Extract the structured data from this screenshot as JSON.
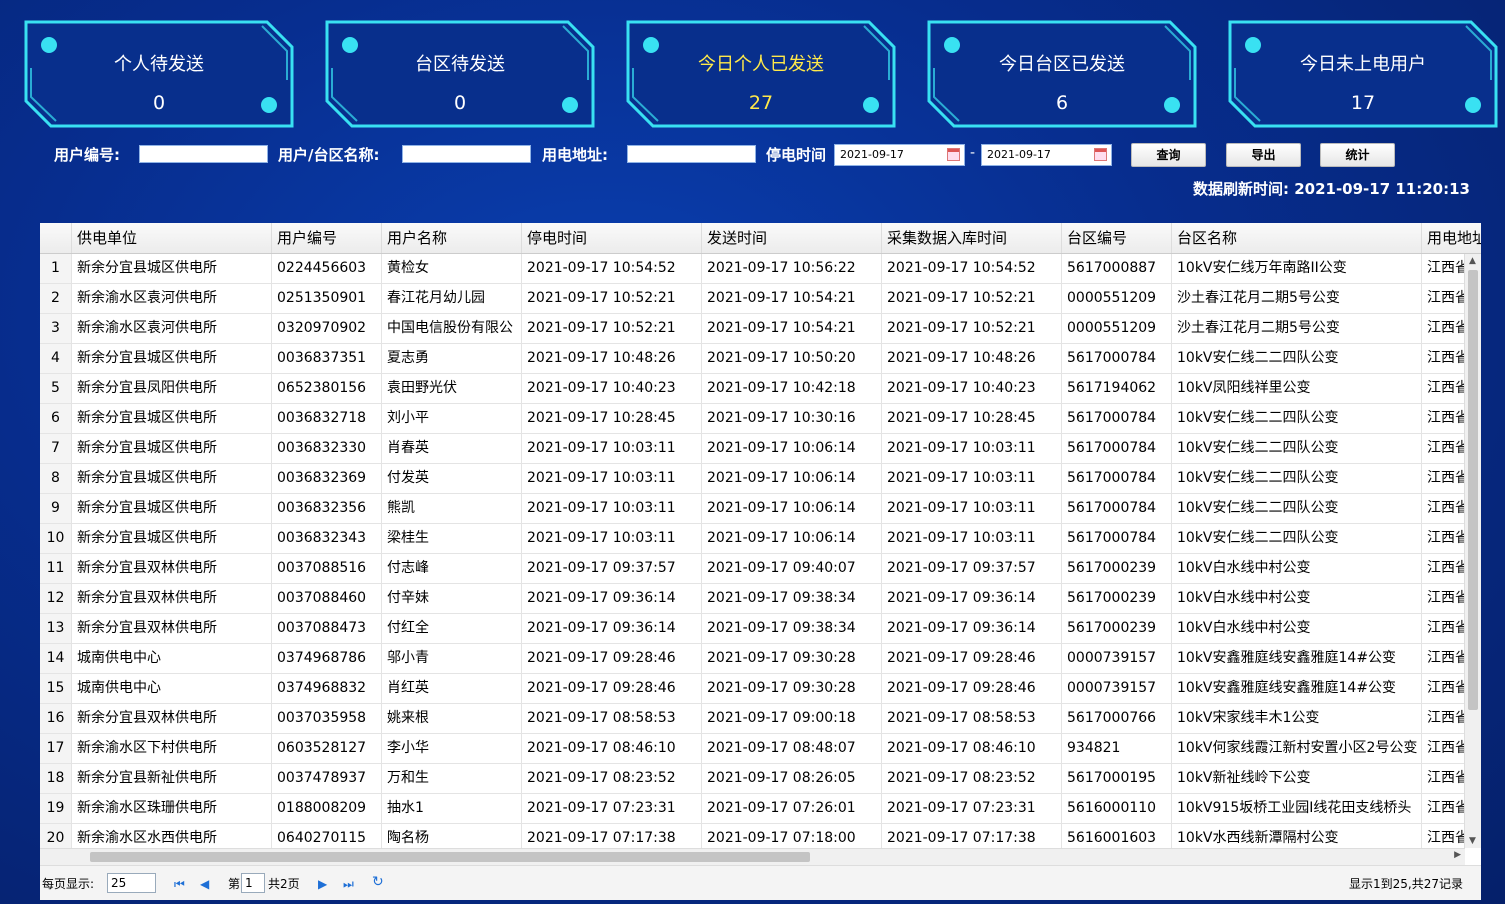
{
  "cards": [
    {
      "title": "个人待发送",
      "value": "0",
      "highlight": false
    },
    {
      "title": "台区待发送",
      "value": "0",
      "highlight": false
    },
    {
      "title": "今日个人已发送",
      "value": "27",
      "highlight": true
    },
    {
      "title": "今日台区已发送",
      "value": "6",
      "highlight": false
    },
    {
      "title": "今日未上电用户",
      "value": "17",
      "highlight": false
    }
  ],
  "filters": {
    "user_no_label": "用户编号:",
    "user_no_value": "",
    "name_label": "用户/台区名称:",
    "name_value": "",
    "address_label": "用电地址:",
    "address_value": "",
    "outage_label": "停电时间",
    "date_from": "2021-09-17",
    "date_to": "2021-09-17",
    "date_sep": "-"
  },
  "buttons": {
    "query": "查询",
    "export": "导出",
    "stats": "统计"
  },
  "refresh_text": "数据刷新时间: 2021-09-17 11:20:13",
  "table": {
    "columns": [
      "供电单位",
      "用户编号",
      "用户名称",
      "停电时间",
      "发送时间",
      "采集数据入库时间",
      "台区编号",
      "台区名称",
      "用电地址"
    ],
    "rows": [
      [
        "1",
        "新余分宜县城区供电所",
        "0224456603",
        "黄检女",
        "2021-09-17 10:54:52",
        "2021-09-17 10:56:22",
        "2021-09-17 10:54:52",
        "5617000887",
        "10kV安仁线万年南路II公变",
        "江西省"
      ],
      [
        "2",
        "新余渝水区袁河供电所",
        "0251350901",
        "春江花月幼儿园",
        "2021-09-17 10:52:21",
        "2021-09-17 10:54:21",
        "2021-09-17 10:52:21",
        "0000551209",
        "沙土春江花月二期5号公变",
        "江西省"
      ],
      [
        "3",
        "新余渝水区袁河供电所",
        "0320970902",
        "中国电信股份有限公",
        "2021-09-17 10:52:21",
        "2021-09-17 10:54:21",
        "2021-09-17 10:52:21",
        "0000551209",
        "沙土春江花月二期5号公变",
        "江西省"
      ],
      [
        "4",
        "新余分宜县城区供电所",
        "0036837351",
        "夏志勇",
        "2021-09-17 10:48:26",
        "2021-09-17 10:50:20",
        "2021-09-17 10:48:26",
        "5617000784",
        "10kV安仁线二二四队公变",
        "江西省"
      ],
      [
        "5",
        "新余分宜县凤阳供电所",
        "0652380156",
        "袁田野光伏",
        "2021-09-17 10:40:23",
        "2021-09-17 10:42:18",
        "2021-09-17 10:40:23",
        "5617194062",
        "10kV凤阳线祥里公变",
        "江西省"
      ],
      [
        "6",
        "新余分宜县城区供电所",
        "0036832718",
        "刘小平",
        "2021-09-17 10:28:45",
        "2021-09-17 10:30:16",
        "2021-09-17 10:28:45",
        "5617000784",
        "10kV安仁线二二四队公变",
        "江西省"
      ],
      [
        "7",
        "新余分宜县城区供电所",
        "0036832330",
        "肖春英",
        "2021-09-17 10:03:11",
        "2021-09-17 10:06:14",
        "2021-09-17 10:03:11",
        "5617000784",
        "10kV安仁线二二四队公变",
        "江西省"
      ],
      [
        "8",
        "新余分宜县城区供电所",
        "0036832369",
        "付发英",
        "2021-09-17 10:03:11",
        "2021-09-17 10:06:14",
        "2021-09-17 10:03:11",
        "5617000784",
        "10kV安仁线二二四队公变",
        "江西省"
      ],
      [
        "9",
        "新余分宜县城区供电所",
        "0036832356",
        "熊凯",
        "2021-09-17 10:03:11",
        "2021-09-17 10:06:14",
        "2021-09-17 10:03:11",
        "5617000784",
        "10kV安仁线二二四队公变",
        "江西省"
      ],
      [
        "10",
        "新余分宜县城区供电所",
        "0036832343",
        "梁桂生",
        "2021-09-17 10:03:11",
        "2021-09-17 10:06:14",
        "2021-09-17 10:03:11",
        "5617000784",
        "10kV安仁线二二四队公变",
        "江西省"
      ],
      [
        "11",
        "新余分宜县双林供电所",
        "0037088516",
        "付志峰",
        "2021-09-17 09:37:57",
        "2021-09-17 09:40:07",
        "2021-09-17 09:37:57",
        "5617000239",
        "10kV白水线中村公变",
        "江西省"
      ],
      [
        "12",
        "新余分宜县双林供电所",
        "0037088460",
        "付辛妹",
        "2021-09-17 09:36:14",
        "2021-09-17 09:38:34",
        "2021-09-17 09:36:14",
        "5617000239",
        "10kV白水线中村公变",
        "江西省"
      ],
      [
        "13",
        "新余分宜县双林供电所",
        "0037088473",
        "付红全",
        "2021-09-17 09:36:14",
        "2021-09-17 09:38:34",
        "2021-09-17 09:36:14",
        "5617000239",
        "10kV白水线中村公变",
        "江西省"
      ],
      [
        "14",
        "城南供电中心",
        "0374968786",
        "邬小青",
        "2021-09-17 09:28:46",
        "2021-09-17 09:30:28",
        "2021-09-17 09:28:46",
        "0000739157",
        "10kV安鑫雅庭线安鑫雅庭14#公变",
        "江西省"
      ],
      [
        "15",
        "城南供电中心",
        "0374968832",
        "肖红英",
        "2021-09-17 09:28:46",
        "2021-09-17 09:30:28",
        "2021-09-17 09:28:46",
        "0000739157",
        "10kV安鑫雅庭线安鑫雅庭14#公变",
        "江西省"
      ],
      [
        "16",
        "新余分宜县双林供电所",
        "0037035958",
        "姚来根",
        "2021-09-17 08:58:53",
        "2021-09-17 09:00:18",
        "2021-09-17 08:58:53",
        "5617000766",
        "10kV宋家线丰木1公变",
        "江西省"
      ],
      [
        "17",
        "新余渝水区下村供电所",
        "0603528127",
        "李小华",
        "2021-09-17 08:46:10",
        "2021-09-17 08:48:07",
        "2021-09-17 08:46:10",
        "934821",
        "10kV何家线霞江新村安置小区2号公变",
        "江西省"
      ],
      [
        "18",
        "新余分宜县新祉供电所",
        "0037478937",
        "万和生",
        "2021-09-17 08:23:52",
        "2021-09-17 08:26:05",
        "2021-09-17 08:23:52",
        "5617000195",
        "10kV新祉线岭下公变",
        "江西省"
      ],
      [
        "19",
        "新余渝水区珠珊供电所",
        "0188008209",
        "抽水1",
        "2021-09-17 07:23:31",
        "2021-09-17 07:26:01",
        "2021-09-17 07:23:31",
        "5616000110",
        "10kV915坂桥工业园Ⅰ线花田支线桥头",
        "江西省"
      ],
      [
        "20",
        "新余渝水区水西供电所",
        "0640270115",
        "陶名杨",
        "2021-09-17 07:17:38",
        "2021-09-17 07:18:00",
        "2021-09-17 07:17:38",
        "5616001603",
        "10kV水西线新潭隔村公变",
        "江西省"
      ]
    ]
  },
  "pager": {
    "page_size_label": "每页显示:",
    "page_size": "25",
    "page_prefix": "第",
    "page_no": "1",
    "page_total": "共2页",
    "summary": "显示1到25,共27记录"
  },
  "colors": {
    "accent_cyan": "#39e1f2",
    "highlight_yellow": "#ffe94a",
    "bg_blue": "#072d8e"
  },
  "icons": [
    "first-page-icon",
    "prev-page-icon",
    "next-page-icon",
    "last-page-icon",
    "refresh-icon",
    "calendar-icon"
  ]
}
